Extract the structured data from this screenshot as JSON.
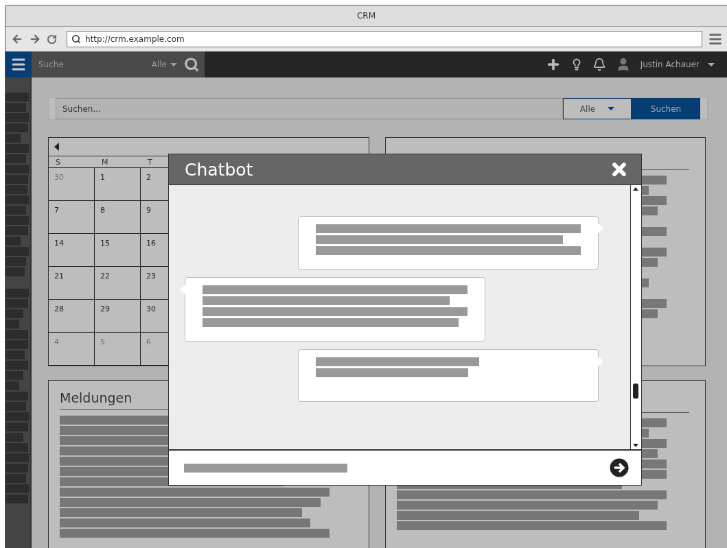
{
  "window": {
    "title": "CRM"
  },
  "browser": {
    "url": "http://crm.example.com"
  },
  "header": {
    "search_label": "Suche",
    "scope": "Alle",
    "user": "Justin Achauer"
  },
  "search_panel": {
    "placeholder": "Suchen...",
    "scope": "Alle",
    "button": "Suchen"
  },
  "calendar": {
    "weekdays": [
      "S",
      "M",
      "T"
    ],
    "weeks": [
      [
        {
          "day": "30",
          "muted": true
        },
        {
          "day": "1",
          "muted": false
        },
        {
          "day": "2",
          "muted": false
        }
      ],
      [
        {
          "day": "7",
          "muted": false
        },
        {
          "day": "8",
          "muted": false
        },
        {
          "day": "9",
          "muted": false
        }
      ],
      [
        {
          "day": "14",
          "muted": false
        },
        {
          "day": "15",
          "muted": false
        },
        {
          "day": "16",
          "muted": false
        }
      ],
      [
        {
          "day": "21",
          "muted": false
        },
        {
          "day": "22",
          "muted": false
        },
        {
          "day": "23",
          "muted": false
        }
      ],
      [
        {
          "day": "28",
          "muted": false
        },
        {
          "day": "29",
          "muted": false
        },
        {
          "day": "30",
          "muted": false
        }
      ],
      [
        {
          "day": "4",
          "muted": true
        },
        {
          "day": "5",
          "muted": true
        },
        {
          "day": "6",
          "muted": true
        }
      ]
    ]
  },
  "news": {
    "title": "Meldungen"
  },
  "chatbot": {
    "title": "Chatbot",
    "messages": [
      {
        "kind": "outgoing"
      },
      {
        "kind": "incoming"
      },
      {
        "kind": "outgoing"
      }
    ]
  }
}
